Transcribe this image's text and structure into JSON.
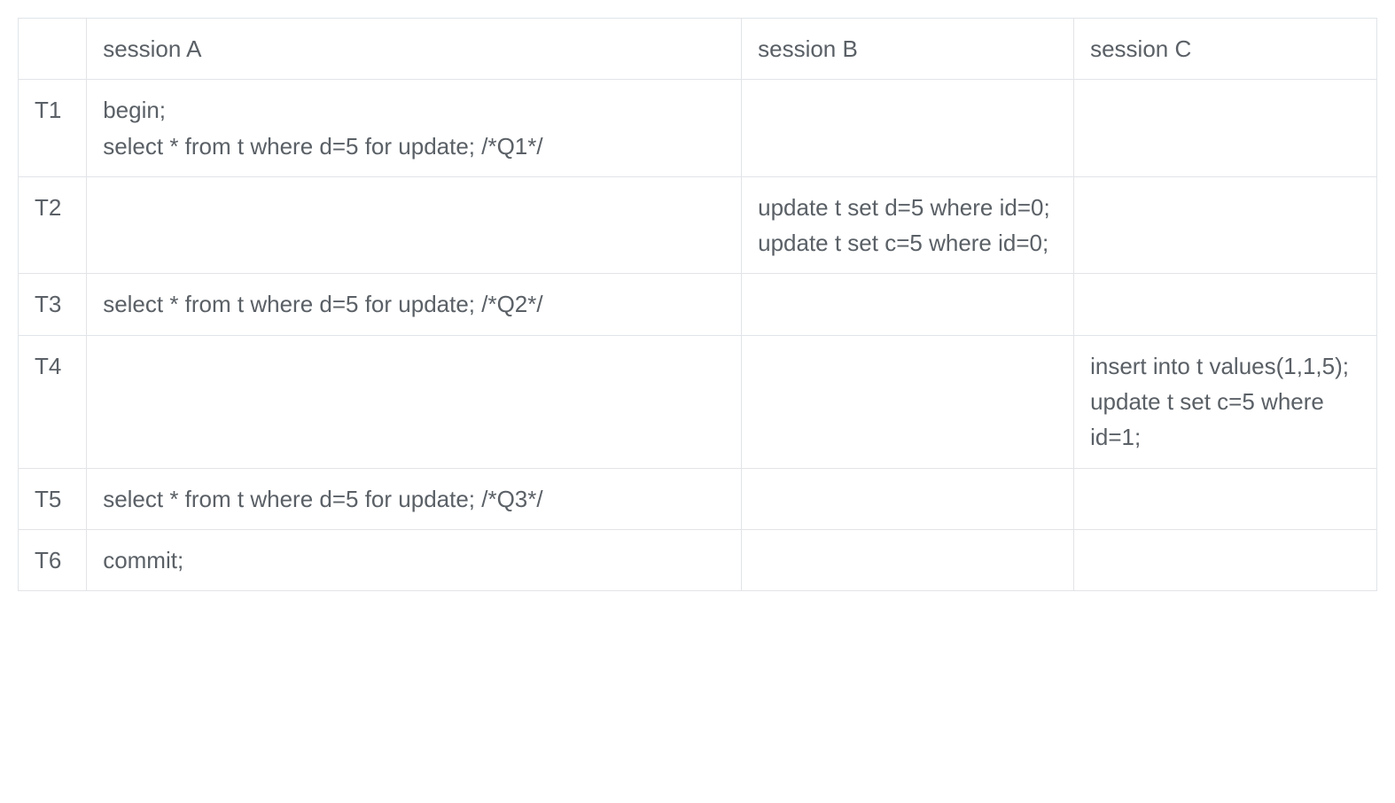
{
  "headers": {
    "corner": "",
    "sessionA": "session A",
    "sessionB": "session B",
    "sessionC": "session C"
  },
  "rows": [
    {
      "time": "T1",
      "a": "begin;\nselect * from t where d=5 for update; /*Q1*/",
      "b": "",
      "c": ""
    },
    {
      "time": "T2",
      "a": "",
      "b": "update t set d=5 where id=0;\nupdate t set c=5 where id=0;",
      "c": ""
    },
    {
      "time": "T3",
      "a": "select * from t where d=5 for update; /*Q2*/",
      "b": "",
      "c": ""
    },
    {
      "time": "T4",
      "a": "",
      "b": "",
      "c": "insert into t values(1,1,5);\nupdate t set c=5 where id=1;"
    },
    {
      "time": "T5",
      "a": "select * from t where d=5 for update; /*Q3*/",
      "b": "",
      "c": ""
    },
    {
      "time": "T6",
      "a": "commit;",
      "b": "",
      "c": ""
    }
  ]
}
